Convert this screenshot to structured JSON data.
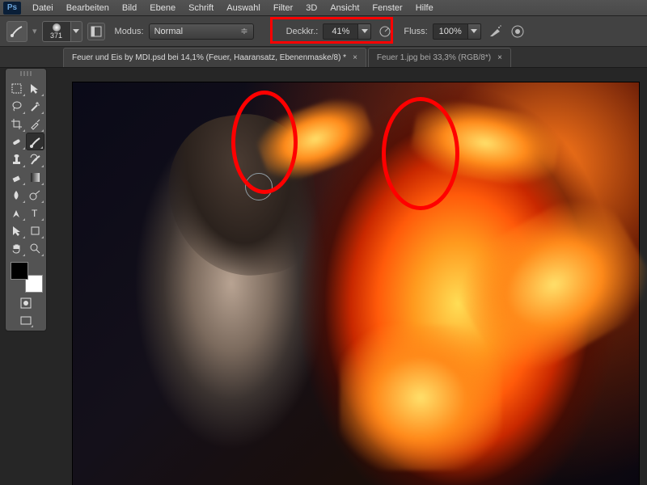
{
  "app_logo": "Ps",
  "menu": [
    "Datei",
    "Bearbeiten",
    "Bild",
    "Ebene",
    "Schrift",
    "Auswahl",
    "Filter",
    "3D",
    "Ansicht",
    "Fenster",
    "Hilfe"
  ],
  "options": {
    "brush_size": "371",
    "modus_label": "Modus:",
    "modus_value": "Normal",
    "deckkr_label": "Deckkr.:",
    "deckkr_value": "41%",
    "fluss_label": "Fluss:",
    "fluss_value": "100%"
  },
  "tabs": [
    {
      "label": "Feuer und Eis by MDI.psd bei 14,1% (Feuer, Haaransatz, Ebenenmaske/8) *",
      "active": true
    },
    {
      "label": "Feuer 1.jpg bei 33,3% (RGB/8*)",
      "active": false
    }
  ],
  "tools": [
    [
      "move",
      "marquee"
    ],
    [
      "lasso",
      "wand"
    ],
    [
      "crop",
      "eyedropper"
    ],
    [
      "heal",
      "brush"
    ],
    [
      "stamp",
      "history-brush"
    ],
    [
      "eraser",
      "gradient"
    ],
    [
      "blur",
      "dodge"
    ],
    [
      "pen",
      "type"
    ],
    [
      "path-select",
      "shape"
    ],
    [
      "hand",
      "zoom"
    ]
  ],
  "swatches": {
    "fg": "#000000",
    "bg": "#ffffff"
  },
  "annotations": {
    "highlight_opacity_field": true,
    "ellipse_left": true,
    "ellipse_right": true
  }
}
